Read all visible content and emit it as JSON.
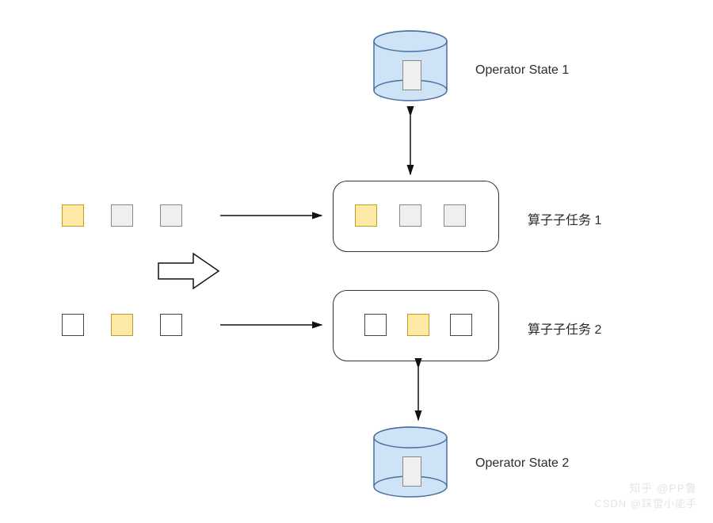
{
  "labels": {
    "state1": "Operator State 1",
    "state2": "Operator State 2",
    "subtask1": "算子子任务 1",
    "subtask2": "算子子任务 2"
  },
  "watermarks": {
    "zhihu": "知乎 @PP鲁",
    "csdn": "CSDN @踩雷小能手"
  },
  "diagram": {
    "top_stream_colors": [
      "yellow",
      "grey",
      "grey"
    ],
    "bottom_stream_colors": [
      "white",
      "yellow",
      "white"
    ],
    "subtask1_box_colors": [
      "yellow",
      "grey",
      "grey"
    ],
    "subtask2_box_colors": [
      "white",
      "yellow",
      "white"
    ]
  }
}
